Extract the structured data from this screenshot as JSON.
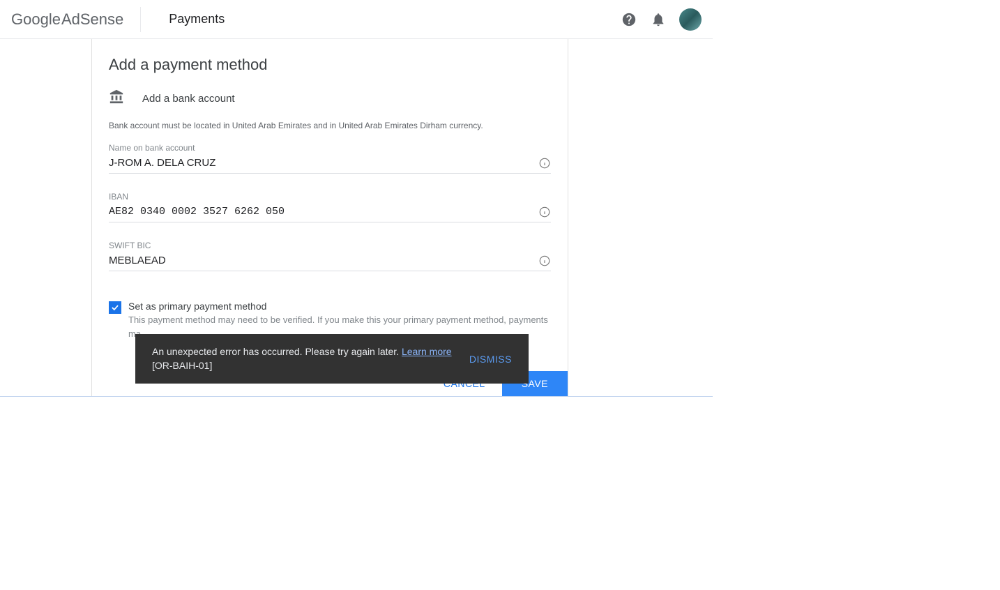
{
  "header": {
    "logo_google": "Google",
    "logo_adsense": " AdSense",
    "title": "Payments"
  },
  "card": {
    "title": "Add a payment method",
    "subsection": "Add a bank account",
    "notice": "Bank account must be located in United Arab Emirates and in United Arab Emirates Dirham currency.",
    "fields": {
      "name": {
        "label": "Name on bank account",
        "value": "J-ROM A. DELA CRUZ"
      },
      "iban": {
        "label": "IBAN",
        "value": "AE82 0340 0002 3527 6262 050"
      },
      "swift": {
        "label": "SWIFT BIC",
        "value": "MEBLAEAD"
      }
    },
    "checkbox": {
      "label": "Set as primary payment method",
      "desc": "This payment method may need to be verified. If you make this your primary payment method, payments ma"
    },
    "buttons": {
      "cancel": "Cancel",
      "save": "Save"
    }
  },
  "toast": {
    "message": "An unexpected error has occurred. Please try again later. ",
    "link": "Learn more",
    "code": "[OR-BAIH-01]",
    "dismiss": "Dismiss"
  }
}
